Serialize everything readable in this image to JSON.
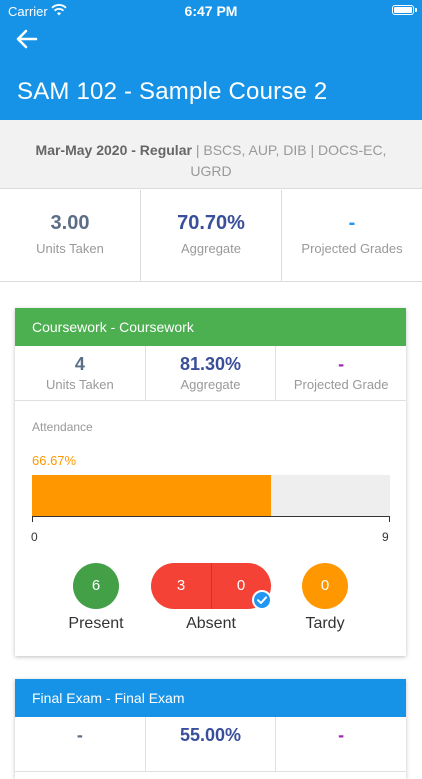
{
  "status_bar": {
    "carrier": "Carrier",
    "time": "6:47 PM"
  },
  "header": {
    "title": "SAM 102 - Sample Course 2"
  },
  "term": {
    "period": "Mar-May 2020 - Regular",
    "details": " | BSCS, AUP, DIB | DOCS-EC, UGRD"
  },
  "summary": [
    {
      "value": "3.00",
      "label": "Units Taken"
    },
    {
      "value": "70.70%",
      "label": "Aggregate"
    },
    {
      "value": "-",
      "label": "Projected Grades"
    }
  ],
  "coursework": {
    "title": "Coursework - Coursework",
    "color": "#4caf50",
    "stats": [
      {
        "value": "4",
        "label": "Units Taken"
      },
      {
        "value": "81.30%",
        "label": "Aggregate"
      },
      {
        "value": "-",
        "label": "Projected Grade"
      }
    ],
    "attendance": {
      "label": "Attendance",
      "percent_text": "66.67%",
      "fill_fraction": 0.6667,
      "axis_min": "0",
      "axis_max": "9",
      "present": {
        "count": "6",
        "label": "Present"
      },
      "absent": {
        "count_a": "3",
        "count_b": "0",
        "label": "Absent"
      },
      "tardy": {
        "count": "0",
        "label": "Tardy"
      }
    }
  },
  "final_exam": {
    "title": "Final Exam - Final Exam",
    "color": "#1693e6",
    "stats": [
      {
        "value": "-"
      },
      {
        "value": "55.00%"
      },
      {
        "value": "-"
      }
    ]
  }
}
